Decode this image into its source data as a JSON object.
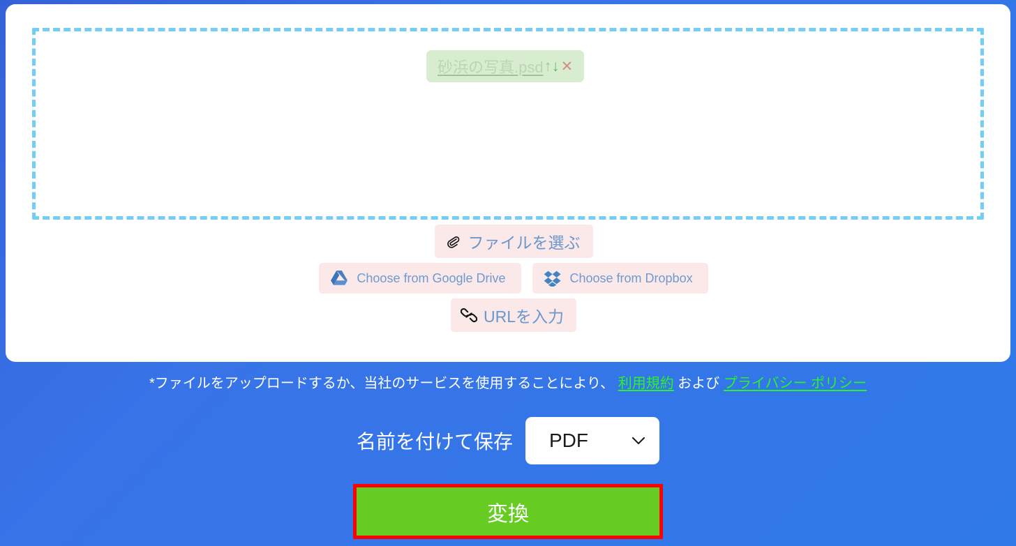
{
  "page": {
    "background_color": "#3873e8"
  },
  "upload_card": {
    "dropzone": {
      "border_color": "#74cdf5",
      "file_chip": {
        "filename": "砂浜の写真.psd",
        "background_color": "#d8edd0",
        "move_up_glyph": "↑",
        "move_down_glyph": "↓",
        "remove_glyph": "✕",
        "move_up_name": "move-file-up",
        "move_down_name": "move-file-down",
        "remove_name": "remove-file"
      }
    },
    "source_buttons": {
      "choose_file": {
        "label": "ファイルを選ぶ",
        "icon": "paperclip-icon"
      },
      "google_drive": {
        "label": "Choose from Google Drive",
        "icon": "google-drive-icon"
      },
      "dropbox": {
        "label": "Choose from Dropbox",
        "icon": "dropbox-icon"
      },
      "enter_url": {
        "label": "URLを入力",
        "icon": "link-icon"
      },
      "background_color": "#fbe9e9",
      "text_color": "#6b97ce"
    }
  },
  "terms": {
    "prefix": "*ファイルをアップロードするか、当社のサービスを使用することにより、 ",
    "terms_link": "利用規約",
    "middle": " および ",
    "privacy_link": "プライバシー ポリシー",
    "link_color": "#2bf32b"
  },
  "save_as": {
    "label": "名前を付けて保存",
    "selected_format": "PDF",
    "chevron_icon": "chevron-down-icon"
  },
  "convert": {
    "label": "変換",
    "button_color": "#66cc22",
    "highlight_color": "#ff0000"
  }
}
